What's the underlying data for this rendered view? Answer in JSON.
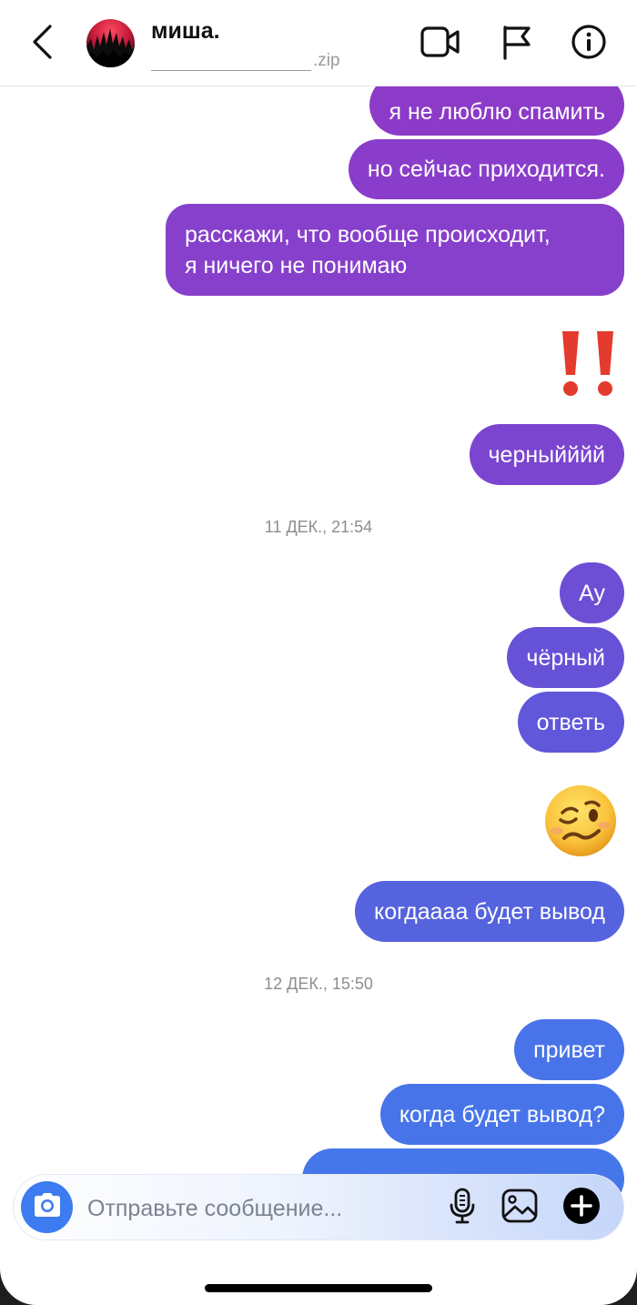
{
  "header": {
    "contact_name": "миша.",
    "contact_subtitle": ".zip",
    "icons": [
      "back-icon",
      "video-call-icon",
      "flag-icon",
      "info-icon"
    ]
  },
  "colors": {
    "bubble_top": "#8e3ec9",
    "bubble_bottom": "#4677ea",
    "accent_blue": "#3d7bf0",
    "exclamation_red": "#e33b2e"
  },
  "messages": [
    {
      "type": "text",
      "text": "я не люблю спамить"
    },
    {
      "type": "text",
      "text": "но сейчас приходится."
    },
    {
      "type": "text",
      "lines": [
        "расскажи, что вообще происходит,",
        "я ничего не понимаю"
      ]
    },
    {
      "type": "emoji",
      "text": "‼️",
      "icon": "double-exclamation-icon"
    },
    {
      "type": "text",
      "text": "черныйййй"
    },
    {
      "type": "timestamp",
      "text": "11 ДЕК., 21:54"
    },
    {
      "type": "text",
      "text": "Ау"
    },
    {
      "type": "text",
      "text": "чёрный"
    },
    {
      "type": "text",
      "text": "ответь"
    },
    {
      "type": "emoji",
      "text": "🥴",
      "icon": "woozy-face-icon"
    },
    {
      "type": "text",
      "text": "когдаааа будет вывод"
    },
    {
      "type": "timestamp",
      "text": "12 ДЕК., 15:50"
    },
    {
      "type": "text",
      "text": "привет"
    },
    {
      "type": "text",
      "text": "когда будет вывод?"
    }
  ],
  "composer": {
    "placeholder": "Отправьте сообщение...",
    "icons": [
      "camera-icon",
      "microphone-icon",
      "gallery-icon",
      "plus-icon"
    ]
  }
}
